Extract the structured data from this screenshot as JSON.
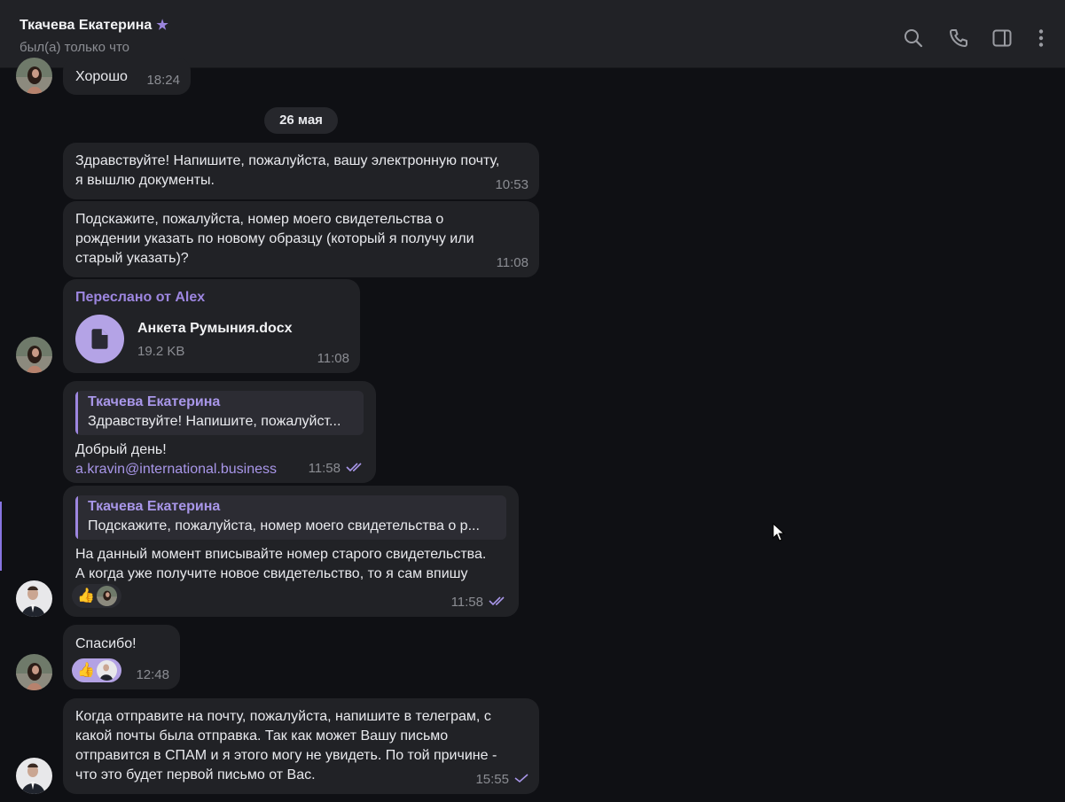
{
  "header": {
    "name": "Ткачева Екатерина",
    "star": "★",
    "status": "был(а) только что",
    "icons": [
      "search-icon",
      "phone-icon",
      "sidebar-icon",
      "more-icon"
    ]
  },
  "date_separator": "26 мая",
  "messages": [
    {
      "text": "Хорошо",
      "time": "18:24"
    },
    {
      "text": "Здравствуйте! Напишите, пожалуйста, вашу электронную почту,\nя вышлю документы.",
      "time": "10:53"
    },
    {
      "text": "Подскажите, пожалуйста, номер моего свидетельства о\nрождении указать по новому образцу (который я получу или\nстарый указать)?",
      "time": "11:08"
    },
    {
      "forwarded": "Переслано от Alex",
      "file_name": "Анкета Румыния.docx",
      "file_size": "19.2 KB",
      "time": "11:08"
    },
    {
      "reply_author": "Ткачева Екатерина",
      "reply_text": "Здравствуйте! Напишите, пожалуйст...",
      "text": "Добрый день!",
      "link": "a.kravin@international.business",
      "time": "11:58"
    },
    {
      "reply_author": "Ткачева Екатерина",
      "reply_text": "Подскажите, пожалуйста, номер моего свидетельства о р...",
      "text": "На данный момент вписывайте номер старого свидетельства.\nА когда уже получите новое свидетельство, то я сам впишу",
      "reaction": "👍",
      "time": "11:58"
    },
    {
      "text": "Спасибо!",
      "reaction": "👍",
      "time": "12:48"
    },
    {
      "text": "Когда отправите на почту, пожалуйста, напишите в телеграм, с\nкакой почты была отправка. Так как может Вашу письмо\nотправится в СПАМ и я этого могу не увидеть. По той причине -\nчто это будет первой письмо от Вас.",
      "time": "15:55"
    }
  ],
  "colors": {
    "background": "#0f1014",
    "bubble": "#212226",
    "accent": "#9d86e0",
    "header": "#212226"
  }
}
